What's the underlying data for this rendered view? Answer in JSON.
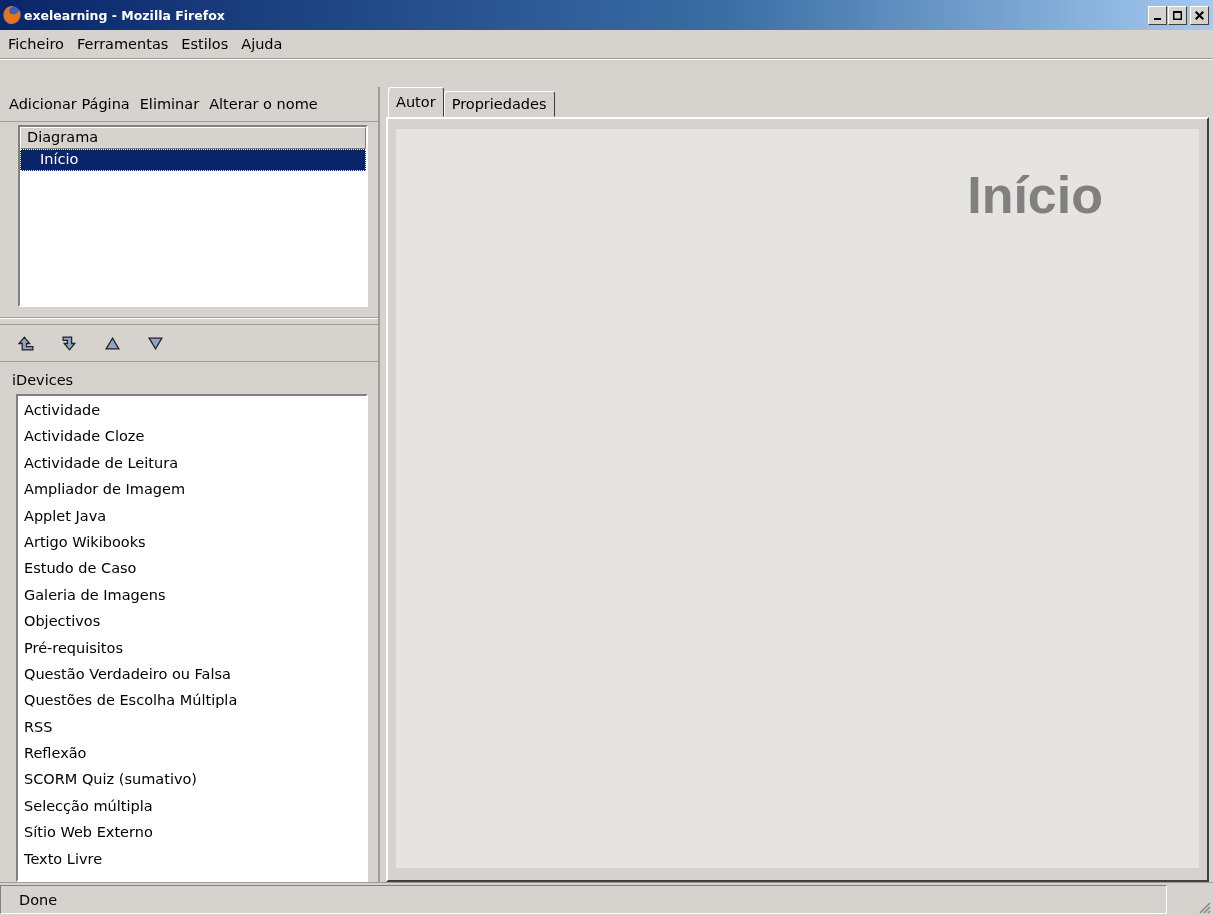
{
  "window": {
    "title": "exelearning - Mozilla Firefox"
  },
  "menu": [
    "Ficheiro",
    "Ferramentas",
    "Estilos",
    "Ajuda"
  ],
  "outline_toolbar": [
    "Adicionar Página",
    "Eliminar",
    "Alterar o nome"
  ],
  "outline": {
    "heading": "Diagrama",
    "items": [
      {
        "label": "Início",
        "selected": true
      }
    ]
  },
  "idevices": {
    "heading": "iDevices",
    "items": [
      "Actividade",
      "Actividade Cloze",
      "Actividade de Leitura",
      "Ampliador de Imagem",
      "Applet Java",
      "Artigo Wikibooks",
      "Estudo de Caso",
      "Galeria de Imagens",
      "Objectivos",
      "Pré-requisitos",
      "Questão Verdadeiro ou Falsa",
      "Questões de Escolha Múltipla",
      "RSS",
      "Reflexão",
      "SCORM Quiz (sumativo)",
      "Selecção múltipla",
      "Sítio Web Externo",
      "Texto Livre"
    ]
  },
  "tabs": [
    {
      "label": "Autor",
      "selected": true
    },
    {
      "label": "Propriedades",
      "selected": false
    }
  ],
  "page": {
    "title": "Início"
  },
  "status_bar": "Done"
}
